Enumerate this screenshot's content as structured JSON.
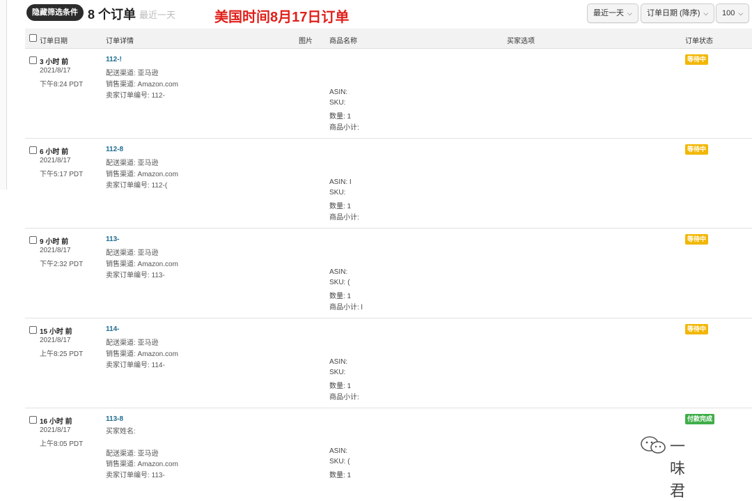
{
  "toolbar": {
    "hide_filters_label": "隐藏筛选条件",
    "order_count": "8 个订单",
    "range_label": "最近一天",
    "annotation": "美国时间8月17日订单",
    "range_select": "最近一天",
    "sort_select": "订单日期 (降序)",
    "page_size_select": "100"
  },
  "columns": {
    "order_date": "订单日期",
    "order_details": "订单详情",
    "image": "图片",
    "product_name": "商品名称",
    "buyer_options": "买家选项",
    "order_status": "订单状态"
  },
  "colors": {
    "pending": "#f2b705",
    "paid": "#3fae49",
    "annotation": "#e0201b",
    "order_link": "#1b6b8f"
  },
  "rows": [
    {
      "time_ago": "3 小时 前",
      "date": "2021/8/17",
      "time": "下午8:24 PDT",
      "order_id": "112-!",
      "fulfillment": "配送渠道: 亚马逊",
      "channel": "销售渠道: Amazon.com",
      "seller_order": "卖家订单编号: 112-",
      "asin": "ASIN: ",
      "sku": "SKU:",
      "qty": "数量: 1",
      "subtotal": "商品小计:",
      "status": "等待中"
    },
    {
      "time_ago": "6 小时 前",
      "date": "2021/8/17",
      "time": "下午5:17 PDT",
      "order_id": "112-8",
      "fulfillment": "配送渠道: 亚马逊",
      "channel": "销售渠道: Amazon.com",
      "seller_order": "卖家订单编号: 112-(",
      "asin": "ASIN: I",
      "sku": "SKU:",
      "qty": "数量: 1",
      "subtotal": "商品小计:",
      "status": "等待中"
    },
    {
      "time_ago": "9 小时 前",
      "date": "2021/8/17",
      "time": "下午2:32 PDT",
      "order_id": "113-",
      "fulfillment": "配送渠道: 亚马逊",
      "channel": "销售渠道: Amazon.com",
      "seller_order": "卖家订单编号: 113-",
      "asin": "ASIN:",
      "sku": "SKU: (",
      "qty": "数量: 1",
      "subtotal": "商品小计: l",
      "status": "等待中"
    },
    {
      "time_ago": "15 小时 前",
      "date": "2021/8/17",
      "time": "上午8:25 PDT",
      "order_id": "114-",
      "fulfillment": "配送渠道: 亚马逊",
      "channel": "销售渠道: Amazon.com",
      "seller_order": "卖家订单编号: 114-",
      "asin": "ASIN:",
      "sku": "SKU:",
      "qty": "数量: 1",
      "subtotal": "商品小计:",
      "status": "等待中"
    },
    {
      "time_ago": "16 小时 前",
      "date": "2021/8/17",
      "time": "上午8:05 PDT",
      "order_id": "113-8",
      "buyer_name": "买家姓名:",
      "fulfillment": "配送渠道: 亚马逊",
      "channel": "销售渠道: Amazon.com",
      "seller_order": "卖家订单编号: 113-",
      "asin": "ASIN:",
      "sku": "SKU: (",
      "qty": "数量: 1",
      "status": "付款完成"
    }
  ],
  "watermark": {
    "text": "一味君",
    "icon": "wechat-official-account-icon"
  }
}
